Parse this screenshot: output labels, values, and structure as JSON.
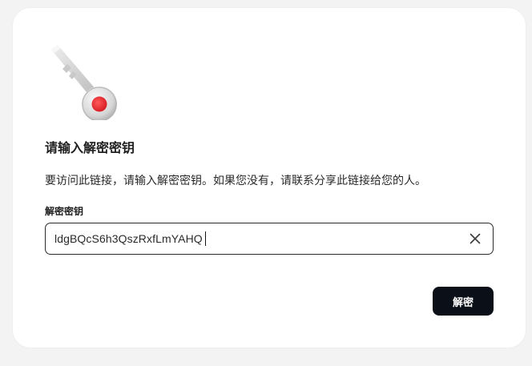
{
  "dialog": {
    "title": "请输入解密密钥",
    "description": "要访问此链接，请输入解密密钥。如果您没有，请联系分享此链接给您的人。",
    "field_label": "解密密钥",
    "input_value": "ldgBQcS6h3QszRxfLmYAHQ",
    "clear_icon": "close-icon",
    "decrypt_label": "解密",
    "illustration": "key-icon"
  },
  "colors": {
    "page_bg": "#f3f3f3",
    "card_bg": "#ffffff",
    "button_bg": "#0b0f17",
    "button_text": "#ffffff",
    "key_accent": "#e8343a"
  }
}
